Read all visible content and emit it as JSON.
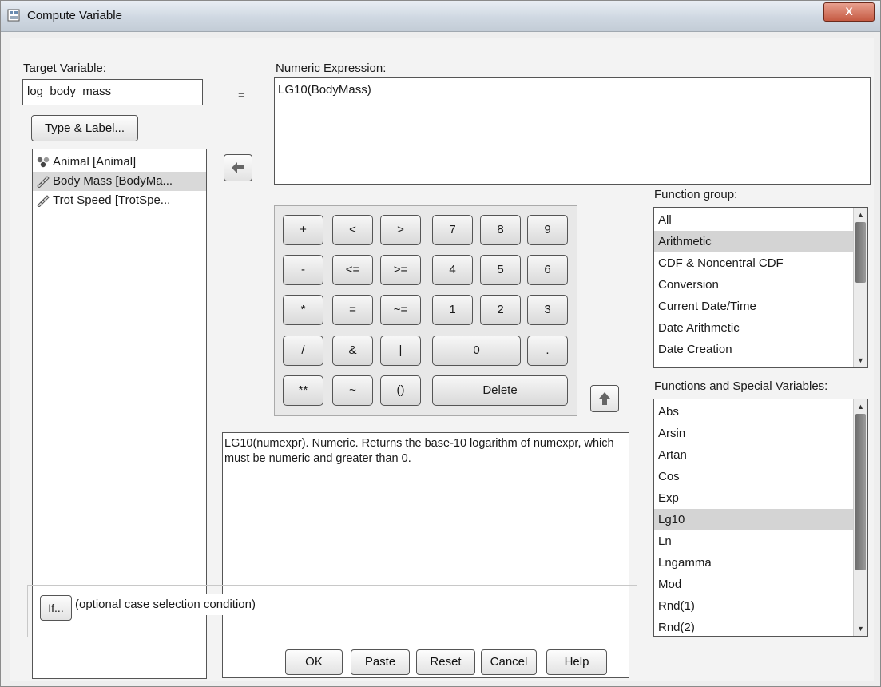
{
  "window": {
    "title": "Compute Variable",
    "close_label": "X"
  },
  "target": {
    "label": "Target Variable:",
    "value": "log_body_mass",
    "type_label_button": "Type & Label..."
  },
  "equals": "=",
  "expression": {
    "label": "Numeric Expression:",
    "value": "LG10(BodyMass)"
  },
  "variables": [
    {
      "label": "Animal [Animal]",
      "icon": "nominal-variable-icon"
    },
    {
      "label": "Body Mass [BodyMa...",
      "icon": "scale-variable-icon"
    },
    {
      "label": "Trot Speed [TrotSpe...",
      "icon": "scale-variable-icon"
    }
  ],
  "keypad": {
    "plus": "+",
    "lt": "<",
    "gt": ">",
    "k7": "7",
    "k8": "8",
    "k9": "9",
    "minus": "-",
    "le": "<=",
    "ge": ">=",
    "k4": "4",
    "k5": "5",
    "k6": "6",
    "mult": "*",
    "eq": "=",
    "ne": "~=",
    "k1": "1",
    "k2": "2",
    "k3": "3",
    "div": "/",
    "and": "&",
    "or": "|",
    "k0": "0",
    "dot": ".",
    "pow": "**",
    "not": "~",
    "parens": "()",
    "delete": "Delete"
  },
  "description": "LG10(numexpr). Numeric. Returns the base-10 logarithm of numexpr, which must be numeric and greater than 0.",
  "function_group": {
    "label": "Function group:",
    "items": [
      "All",
      "Arithmetic",
      "CDF & Noncentral CDF",
      "Conversion",
      "Current Date/Time",
      "Date Arithmetic",
      "Date Creation"
    ],
    "selected": "Arithmetic"
  },
  "functions": {
    "label": "Functions and Special Variables:",
    "items": [
      "Abs",
      "Arsin",
      "Artan",
      "Cos",
      "Exp",
      "Lg10",
      "Ln",
      "Lngamma",
      "Mod",
      "Rnd(1)",
      "Rnd(2)"
    ],
    "selected": "Lg10"
  },
  "if_section": {
    "button": "If...",
    "text": "(optional case selection condition)"
  },
  "buttons": {
    "ok": "OK",
    "paste": "Paste",
    "reset": "Reset",
    "cancel": "Cancel",
    "help": "Help"
  }
}
